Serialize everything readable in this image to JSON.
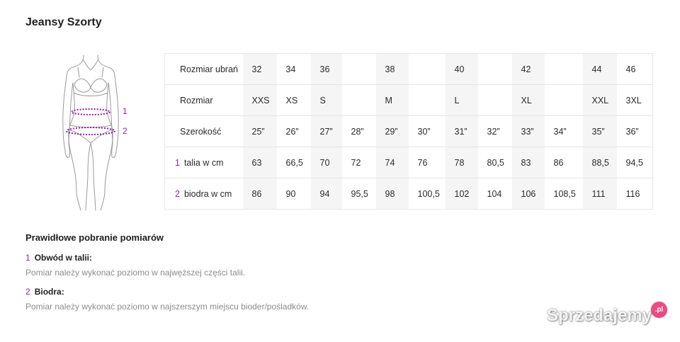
{
  "page": {
    "title": "Jeansy Szorty"
  },
  "figure": {
    "waist_marker": "1",
    "hips_marker": "2"
  },
  "table": {
    "rows": [
      {
        "label": "Rozmiar ubrań",
        "cells": [
          "32",
          "34",
          "36",
          "",
          "38",
          "",
          "40",
          "",
          "42",
          "",
          "44",
          "46"
        ]
      },
      {
        "label": "Rozmiar",
        "cells": [
          "XXS",
          "XS",
          "S",
          "",
          "M",
          "",
          "L",
          "",
          "XL",
          "",
          "XXL",
          "3XL"
        ]
      },
      {
        "label": "Szerokość",
        "cells": [
          "25”",
          "26”",
          "27”",
          "28”",
          "29”",
          "30”",
          "31”",
          "32”",
          "33”",
          "34”",
          "35”",
          "36”"
        ]
      },
      {
        "marker": "1",
        "label": "talia w cm",
        "cells": [
          "63",
          "66,5",
          "70",
          "72",
          "74",
          "76",
          "78",
          "80,5",
          "83",
          "86",
          "88,5",
          "94,5"
        ]
      },
      {
        "marker": "2",
        "label": "biodra w cm",
        "cells": [
          "86",
          "90",
          "94",
          "95,5",
          "98",
          "100,5",
          "102",
          "104",
          "106",
          "108,5",
          "111",
          "116"
        ]
      }
    ]
  },
  "instructions": {
    "heading": "Prawidłowe pobranie pomiarów",
    "items": [
      {
        "marker": "1",
        "title": "Obwód w talii:",
        "text": "Pomiar należy wykonać poziomo w najwęższej części talii."
      },
      {
        "marker": "2",
        "title": "Biodra:",
        "text": "Pomiar należy wykonać poziomo w najszerszym miejscu bioder/pośladków."
      }
    ]
  },
  "watermark": {
    "text": "Sprzedajemy",
    "suffix": ".pl"
  },
  "colors": {
    "accent": "#8e24aa",
    "column_shade": "#f5f5f5",
    "grid_line": "#e6e6e6",
    "muted_text": "#8c8c8c",
    "watermark_dot": "#e91e63"
  }
}
